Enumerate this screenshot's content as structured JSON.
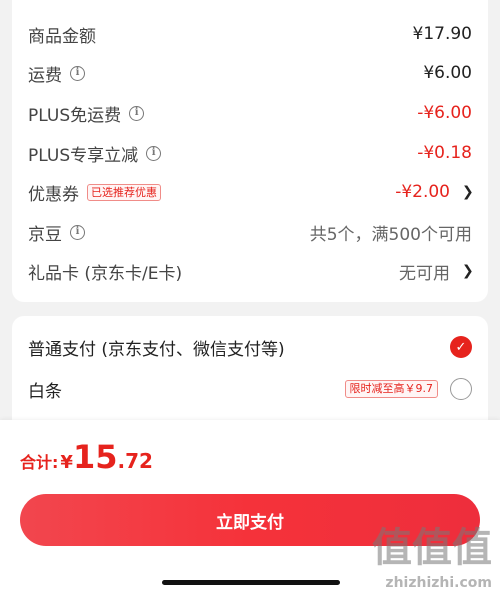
{
  "summary": {
    "goods_amount": {
      "label": "商品金额",
      "value": "¥17.90"
    },
    "shipping": {
      "label": "运费",
      "value": "¥6.00"
    },
    "plus_free_shipping": {
      "label": "PLUS免运费",
      "value": "-¥6.00"
    },
    "plus_discount": {
      "label": "PLUS专享立减",
      "value": "-¥0.18"
    },
    "coupon": {
      "label": "优惠券",
      "tag": "已选推荐优惠",
      "value": "-¥2.00"
    },
    "jingdou": {
      "label": "京豆",
      "value": "共5个，满500个可用"
    },
    "gift_card": {
      "label": "礼品卡 (京东卡/E卡)",
      "value": "无可用"
    }
  },
  "payment": {
    "normal": {
      "label": "普通支付 (京东支付、微信支付等)",
      "selected": true
    },
    "baitiao": {
      "label": "白条",
      "promo": "限时减至高￥9.7",
      "selected": false
    }
  },
  "footer": {
    "total_label": "合计:",
    "currency": "¥",
    "total_int": "15",
    "total_dec": ".72",
    "pay_button": "立即支付"
  },
  "watermark": {
    "text": "值值值",
    "url": "zhizhizhi.com"
  },
  "colors": {
    "accent": "#e6231d",
    "button": "#f5323a"
  },
  "icons": {
    "info": "info-circle-icon",
    "chevron": "chevron-right-icon",
    "check": "check-circle-icon"
  }
}
